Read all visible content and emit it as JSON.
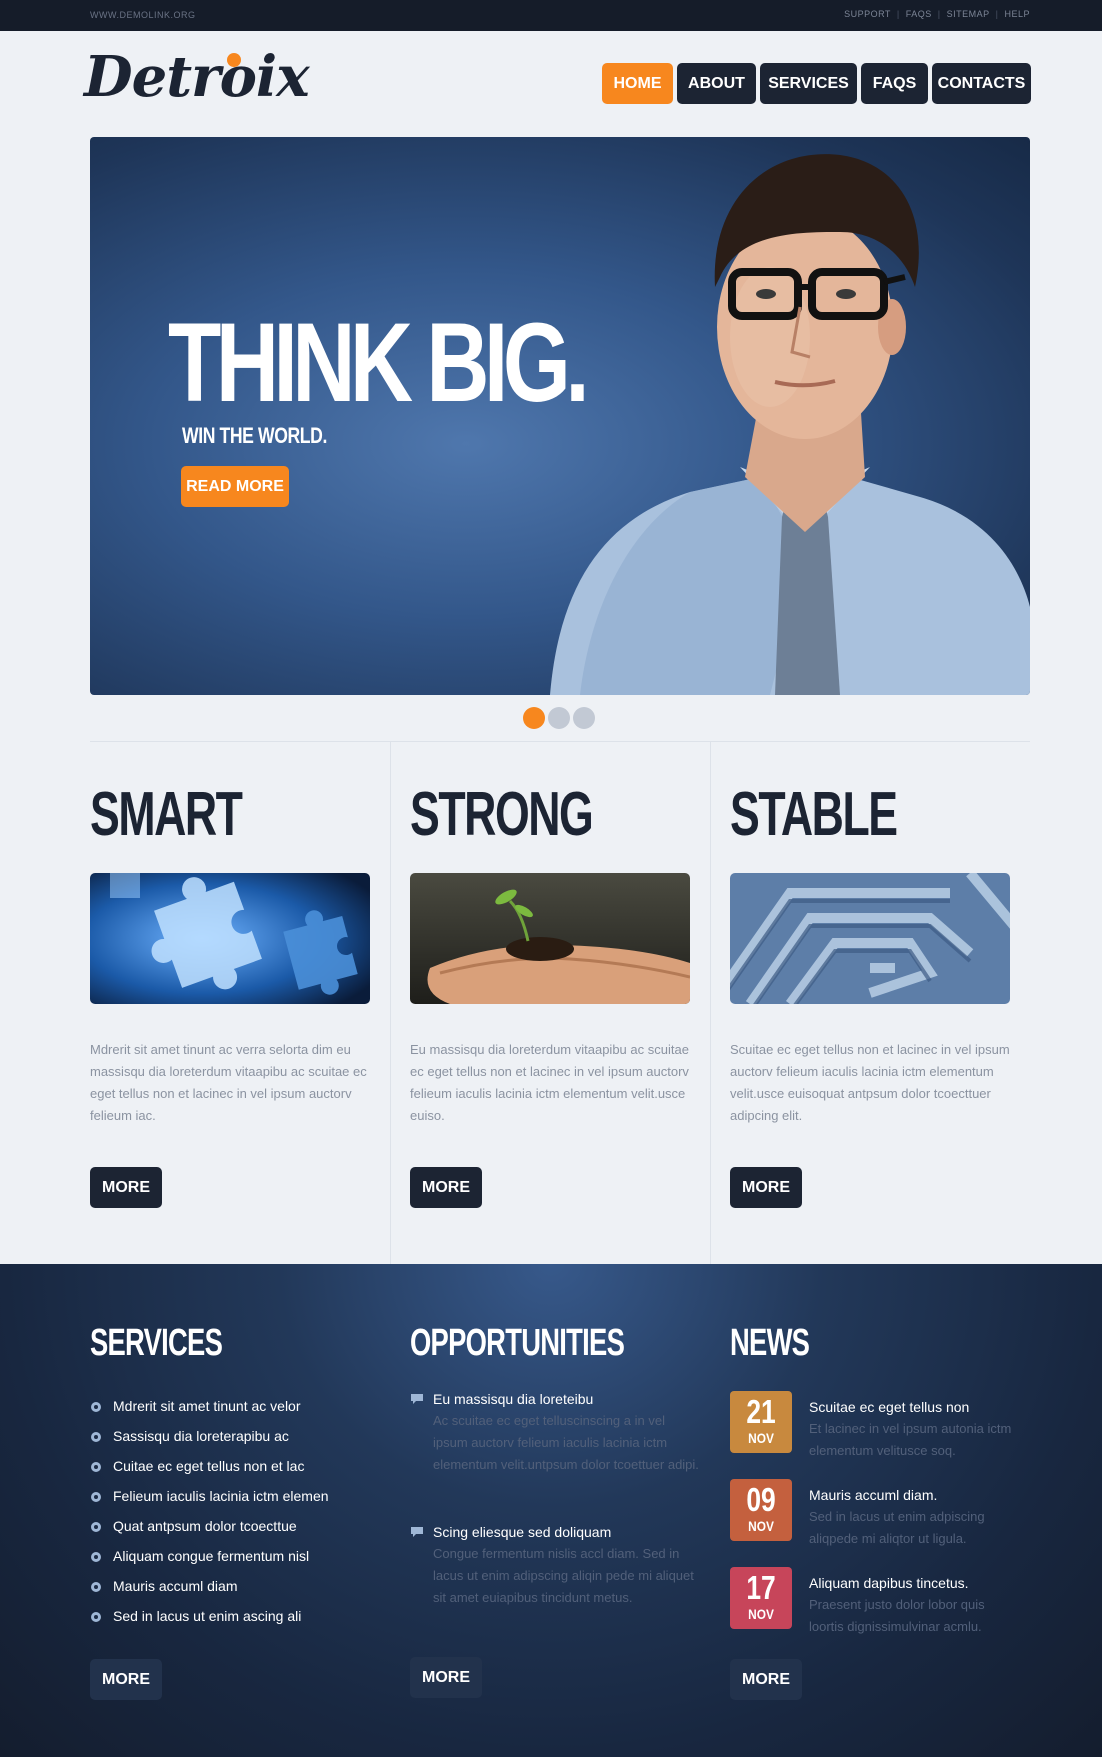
{
  "topbar": {
    "domain": "WWW.DEMOLINK.ORG",
    "links": [
      "SUPPORT",
      "FAQS",
      "SITEMAP",
      "HELP"
    ]
  },
  "header": {
    "logo": "Detroix",
    "nav": [
      "HOME",
      "ABOUT",
      "SERVICES",
      "FAQS",
      "CONTACTS"
    ],
    "active_nav": "HOME"
  },
  "hero": {
    "title": "THINK BIG.",
    "subtitle": "WIN THE WORLD.",
    "cta": "READ MORE",
    "slides": 3,
    "active_slide": 1
  },
  "features": [
    {
      "title": "SMART",
      "image": "puzzle-image",
      "text": "Mdrerit sit amet tinunt ac verra selorta dim eu massisqu dia loreterdum vitaapibu ac scuitae ec eget tellus non et lacinec in vel ipsum auctorv felieum iac.",
      "more": "MORE"
    },
    {
      "title": "STRONG",
      "image": "sprout-hand-image",
      "text": "Eu massisqu dia loreterdum vitaapibu ac scuitae ec eget tellus non et lacinec in vel ipsum auctorv felieum iaculis lacinia ictm elementum velit.usce euiso.",
      "more": "MORE"
    },
    {
      "title": "STABLE",
      "image": "maze-image",
      "text": "Scuitae ec eget tellus non et lacinec in vel ipsum auctorv felieum iaculis lacinia ictm elementum velit.usce euisoquat antpsum dolor tcoecttuer adipcing elit.",
      "more": "MORE"
    }
  ],
  "services": {
    "title": "SERVICES",
    "items": [
      "Mdrerit sit amet tinunt ac velor",
      "Sassisqu dia loreterapibu ac",
      "Cuitae ec eget tellus non et lac",
      "Felieum iaculis lacinia ictm elemen",
      "Quat antpsum dolor tcoecttue",
      "Aliquam congue fermentum nisl",
      "Mauris accuml diam",
      "Sed in lacus ut enim ascing ali"
    ],
    "more": "MORE"
  },
  "opportunities": {
    "title": "OPPORTUNITIES",
    "items": [
      {
        "title": "Eu massisqu dia loreteibu",
        "text": "Ac scuitae ec eget telluscinscing a in vel ipsum auctorv felieum iaculis lacinia ictm elementum velit.untpsum dolor tcoettuer adipi."
      },
      {
        "title": "Scing eliesque sed doliquam",
        "text": "Congue fermentum nislis accl diam. Sed in lacus ut enim adipscing aliqin pede mi aliquet sit amet euiapibus tincidunt metus."
      }
    ],
    "more": "MORE"
  },
  "news": {
    "title": "NEWS",
    "items": [
      {
        "day": "21",
        "month": "NOV",
        "color": "#c8893e",
        "title": "Scuitae ec eget tellus non",
        "text": "Et lacinec in vel ipsum autonia ictm elementum velitusce soq."
      },
      {
        "day": "09",
        "month": "NOV",
        "color": "#c4603e",
        "title": "Mauris accuml diam.",
        "text": "Sed in lacus ut enim adpiscing aliqpede mi aliqtor ut ligula."
      },
      {
        "day": "17",
        "month": "NOV",
        "color": "#c7455a",
        "title": "Aliquam dapibus tincetus.",
        "text": "Praesent justo dolor lobor quis loortis dignissimulvinar acmlu."
      }
    ],
    "more": "MORE"
  },
  "colors": {
    "accent": "#f7871e",
    "dark": "#1c2433",
    "footer": "#182740"
  }
}
